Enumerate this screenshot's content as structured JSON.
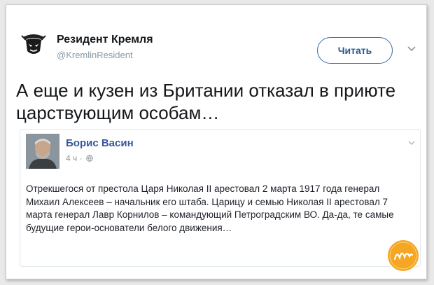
{
  "tweet": {
    "author_name": "Резидент Кремля",
    "author_handle": "@KremlinResident",
    "follow_label": "Читать",
    "text": "А еще и кузен из Британии отказал в приюте царствующим особам…"
  },
  "quoted_post": {
    "author_name": "Борис Васин",
    "time": "4 ч ·",
    "text": "Отрекшегося от престола Царя Николая II арестовал 2 марта 1917 года генерал Михаил Алексеев – начальник его штаба. Царицу и семью Николая II арестовал 7 марта генерал Лавр Корнилов – командующий Петроградским ВО. Да-да, те самые будущие герои-основатели белого движения…"
  },
  "icons": [
    "avatar-logo",
    "chevron-down-icon",
    "globe-icon",
    "watermark-badge"
  ],
  "colors": {
    "follow_border": "#3d6da6",
    "quoted_name": "#365899",
    "badge": "#f5a623"
  }
}
